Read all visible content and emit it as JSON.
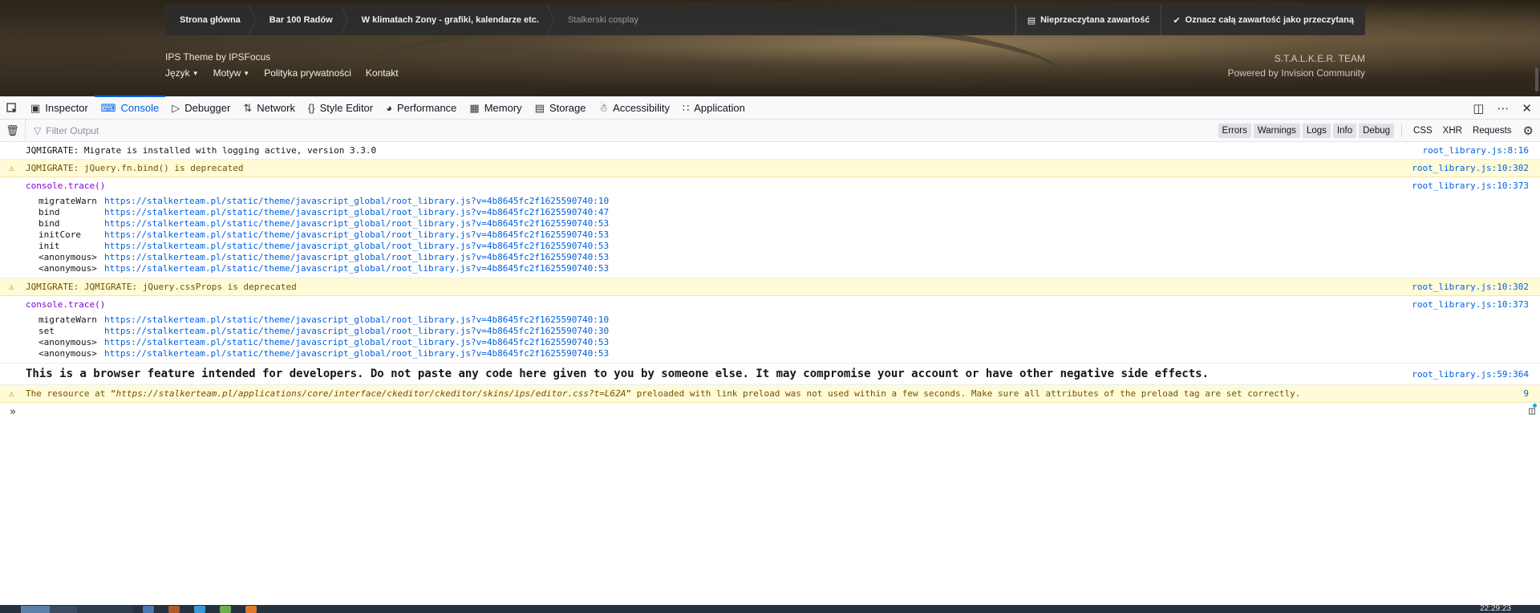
{
  "page": {
    "breadcrumbs": [
      "Strona główna",
      "Bar 100 Radów",
      "W klimatach Zony - grafiki, kalendarze etc.",
      "Stalkerski cosplay"
    ],
    "actions": {
      "unread": "Nieprzeczytana zawartość",
      "mark_read": "Oznacz całą zawartość jako przeczytaną"
    },
    "footer": {
      "theme": "IPS Theme by IPSFocus",
      "links": [
        "Język",
        "Motyw",
        "Polityka prywatności",
        "Kontakt"
      ],
      "team": "S.T.A.L.K.E.R. TEAM",
      "powered": "Powered by Invision Community"
    }
  },
  "devtools": {
    "tabs": [
      {
        "label": "Inspector",
        "icon": "inspector-icon"
      },
      {
        "label": "Console",
        "icon": "console-icon",
        "active": true
      },
      {
        "label": "Debugger",
        "icon": "debugger-icon"
      },
      {
        "label": "Network",
        "icon": "network-icon"
      },
      {
        "label": "Style Editor",
        "icon": "style-editor-icon"
      },
      {
        "label": "Performance",
        "icon": "performance-icon"
      },
      {
        "label": "Memory",
        "icon": "memory-icon"
      },
      {
        "label": "Storage",
        "icon": "storage-icon"
      },
      {
        "label": "Accessibility",
        "icon": "accessibility-icon"
      },
      {
        "label": "Application",
        "icon": "application-icon"
      }
    ],
    "filter": {
      "placeholder": "Filter Output",
      "levels": [
        "Errors",
        "Warnings",
        "Logs",
        "Info",
        "Debug"
      ],
      "types": [
        "CSS",
        "XHR",
        "Requests"
      ]
    }
  },
  "console": {
    "m1": {
      "text": "JQMIGRATE: Migrate is installed with logging active, version 3.3.0",
      "loc": "root_library.js:8:16"
    },
    "m2": {
      "text": "JQMIGRATE: jQuery.fn.bind() is deprecated",
      "loc": "root_library.js:10:302"
    },
    "m3": {
      "head": "console.trace()",
      "loc": "root_library.js:10:373",
      "frames": [
        {
          "fn": "migrateWarn",
          "url": "https://stalkerteam.pl/static/theme/javascript_global/root_library.js?v=4b8645fc2f1625590740:10"
        },
        {
          "fn": "bind",
          "url": "https://stalkerteam.pl/static/theme/javascript_global/root_library.js?v=4b8645fc2f1625590740:47"
        },
        {
          "fn": "bind",
          "url": "https://stalkerteam.pl/static/theme/javascript_global/root_library.js?v=4b8645fc2f1625590740:53"
        },
        {
          "fn": "initCore",
          "url": "https://stalkerteam.pl/static/theme/javascript_global/root_library.js?v=4b8645fc2f1625590740:53"
        },
        {
          "fn": "init",
          "url": "https://stalkerteam.pl/static/theme/javascript_global/root_library.js?v=4b8645fc2f1625590740:53"
        },
        {
          "fn": "<anonymous>",
          "url": "https://stalkerteam.pl/static/theme/javascript_global/root_library.js?v=4b8645fc2f1625590740:53"
        },
        {
          "fn": "<anonymous>",
          "url": "https://stalkerteam.pl/static/theme/javascript_global/root_library.js?v=4b8645fc2f1625590740:53"
        }
      ]
    },
    "m4": {
      "text": "JQMIGRATE: JQMIGRATE: jQuery.cssProps is deprecated",
      "loc": "root_library.js:10:302"
    },
    "m5": {
      "head": "console.trace()",
      "loc": "root_library.js:10:373",
      "frames": [
        {
          "fn": "migrateWarn",
          "url": "https://stalkerteam.pl/static/theme/javascript_global/root_library.js?v=4b8645fc2f1625590740:10"
        },
        {
          "fn": "set",
          "url": "https://stalkerteam.pl/static/theme/javascript_global/root_library.js?v=4b8645fc2f1625590740:30"
        },
        {
          "fn": "<anonymous>",
          "url": "https://stalkerteam.pl/static/theme/javascript_global/root_library.js?v=4b8645fc2f1625590740:53"
        },
        {
          "fn": "<anonymous>",
          "url": "https://stalkerteam.pl/static/theme/javascript_global/root_library.js?v=4b8645fc2f1625590740:53"
        }
      ]
    },
    "m6": {
      "text": "This is a browser feature intended for developers. Do not paste any code here given to you by someone else. It may compromise your account or have other negative side effects.",
      "loc": "root_library.js:59:364"
    },
    "m7": {
      "prefix": "The resource at “",
      "url": "https://stalkerteam.pl/applications/core/interface/ckeditor/ckeditor/skins/ips/editor.css?t=L62A",
      "suffix": "” preloaded with link preload was not used within a few seconds. Make sure all attributes of the preload tag are set correctly.",
      "loc": "9"
    },
    "prompt": "»"
  },
  "taskbar": {
    "clock": "22:29:23"
  },
  "colors": {
    "accent": "#0061e0",
    "warning_bg": "#fffbd6",
    "warning_text": "#715100",
    "trace": "#8000d7"
  }
}
